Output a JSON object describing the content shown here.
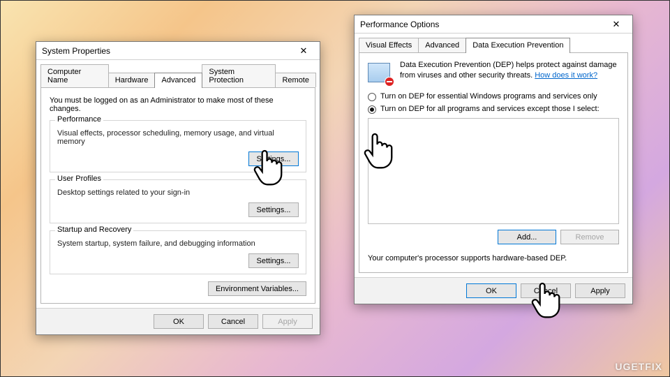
{
  "sysprops": {
    "title": "System Properties",
    "tabs": [
      "Computer Name",
      "Hardware",
      "Advanced",
      "System Protection",
      "Remote"
    ],
    "active_tab": 2,
    "intro": "You must be logged on as an Administrator to make most of these changes.",
    "groups": {
      "performance": {
        "legend": "Performance",
        "desc": "Visual effects, processor scheduling, memory usage, and virtual memory",
        "button": "Settings..."
      },
      "user_profiles": {
        "legend": "User Profiles",
        "desc": "Desktop settings related to your sign-in",
        "button": "Settings..."
      },
      "startup": {
        "legend": "Startup and Recovery",
        "desc": "System startup, system failure, and debugging information",
        "button": "Settings..."
      }
    },
    "env_vars": "Environment Variables...",
    "bottom": {
      "ok": "OK",
      "cancel": "Cancel",
      "apply": "Apply"
    }
  },
  "perfopts": {
    "title": "Performance Options",
    "tabs": [
      "Visual Effects",
      "Advanced",
      "Data Execution Prevention"
    ],
    "active_tab": 2,
    "dep_desc": "Data Execution Prevention (DEP) helps protect against damage from viruses and other security threats. ",
    "dep_link": "How does it work?",
    "radio": {
      "essential": "Turn on DEP for essential Windows programs and services only",
      "all": "Turn on DEP for all programs and services except those I select:",
      "selected": "all"
    },
    "add": "Add...",
    "remove": "Remove",
    "status": "Your computer's processor supports hardware-based DEP.",
    "bottom": {
      "ok": "OK",
      "cancel": "Cancel",
      "apply": "Apply"
    }
  },
  "watermark": "UGETFIX"
}
